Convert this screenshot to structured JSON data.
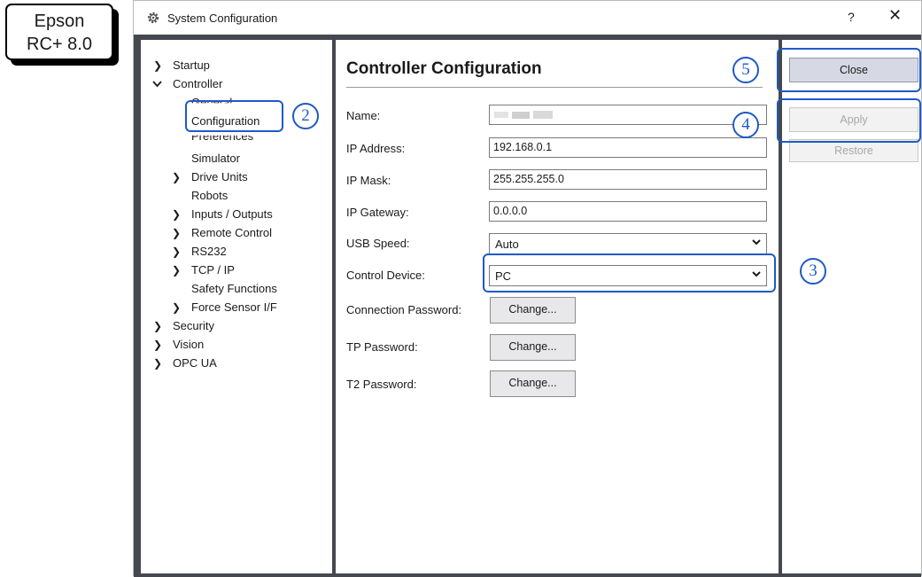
{
  "badge": {
    "line1": "Epson",
    "line2": "RC+ 8.0"
  },
  "window": {
    "title": "System Configuration",
    "help_label": "?",
    "close_label": "✕"
  },
  "tree": {
    "startup": "Startup",
    "controller": "Controller",
    "general": "General",
    "configuration": "Configuration",
    "preferences": "Preferences",
    "simulator": "Simulator",
    "drive_units": "Drive Units",
    "robots": "Robots",
    "inputs_outputs": "Inputs / Outputs",
    "remote_control": "Remote Control",
    "rs232": "RS232",
    "tcp_ip": "TCP / IP",
    "safety_functions": "Safety Functions",
    "force_sensor": "Force Sensor I/F",
    "security": "Security",
    "vision": "Vision",
    "opc_ua": "OPC UA"
  },
  "content": {
    "heading": "Controller Configuration",
    "name_label": "Name:",
    "ip_label": "IP Address:",
    "ip_value": "192.168.0.1",
    "mask_label": "IP Mask:",
    "mask_value": "255.255.255.0",
    "gateway_label": "IP Gateway:",
    "gateway_value": "0.0.0.0",
    "usb_label": "USB Speed:",
    "usb_value": "Auto",
    "control_label": "Control Device:",
    "control_value": "PC",
    "conn_pw_label": "Connection Password:",
    "tp_pw_label": "TP Password:",
    "t2_pw_label": "T2 Password:",
    "change_label": "Change..."
  },
  "buttons": {
    "close": "Close",
    "apply": "Apply",
    "restore": "Restore"
  },
  "callouts": {
    "n2": "2",
    "n3": "3",
    "n4": "4",
    "n5": "5"
  },
  "colors": {
    "accent": "#1e59c8",
    "frame": "#45484f"
  }
}
